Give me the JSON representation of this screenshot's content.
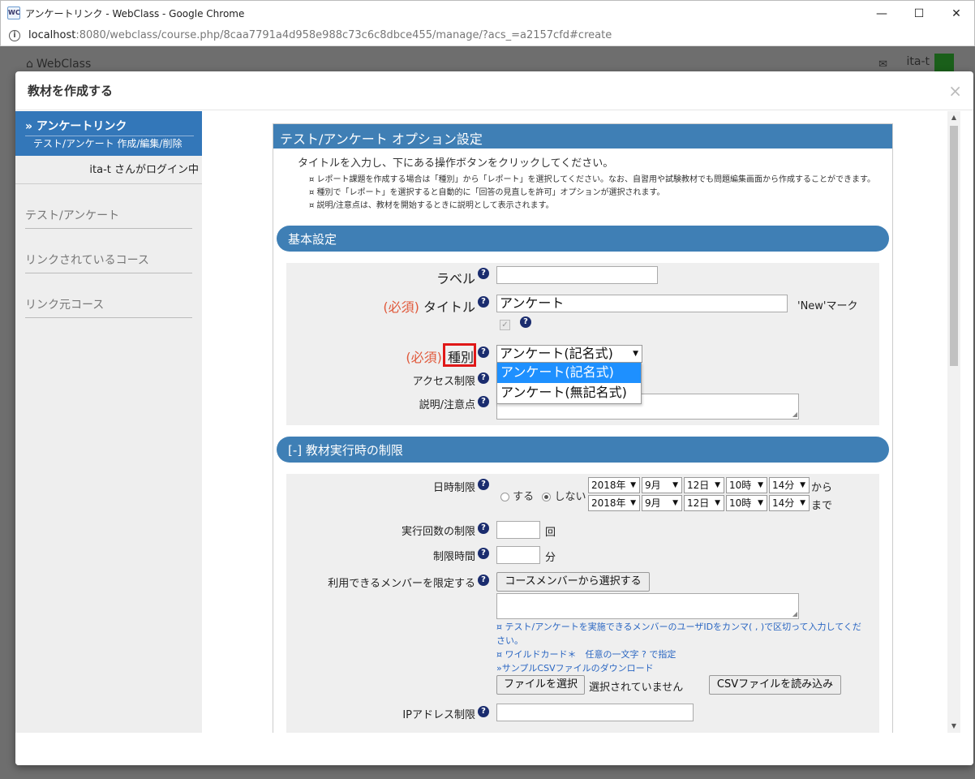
{
  "browser": {
    "window_title": "アンケートリンク - WebClass - Google Chrome",
    "favicon_text": "WC",
    "url_host": "localhost",
    "url_rest": ":8080/webclass/course.php/8caa7791a4d958e988c73c6c8dbce455/manage/?acs_=a2157cfd#create",
    "controls": {
      "minimize": "—",
      "maximize": "☐",
      "close": "✕"
    }
  },
  "background": {
    "brand": "WebClass",
    "user": "ita-t"
  },
  "modal": {
    "title": "教材を作成する",
    "close_label": "×"
  },
  "sidebar": {
    "head_title": "» アンケートリンク",
    "head_sub": "テスト/アンケート 作成/編集/削除",
    "login": "ita-t さんがログイン中",
    "links": [
      "テスト/アンケート",
      "リンクされているコース",
      "リンク元コース"
    ]
  },
  "panel": {
    "header": "テスト/アンケート オプション設定",
    "intro": "タイトルを入力し、下にある操作ボタンをクリックしてください。",
    "notes": [
      "¤ レポート課題を作成する場合は「種別」から「レポート」を選択してください。なお、自習用や試験教材でも問題編集画面から作成することができます。",
      "¤ 種別で「レポート」を選択すると自動的に「回答の見直しを許可」オプションが選択されます。",
      "¤ 説明/注意点は、教材を開始するときに説明として表示されます。"
    ]
  },
  "basic": {
    "section_title": "基本設定",
    "label_label": "ラベル",
    "label_value": "",
    "required_mark": "(必須)",
    "title_label": "タイトル",
    "title_value": "アンケート",
    "new_mark_label": "'New'マーク",
    "type_label": "種別",
    "type_value": "アンケート(記名式)",
    "type_options": [
      "アンケート(記名式)",
      "アンケート(無記名式)"
    ],
    "access_label": "アクセス制限",
    "desc_label": "説明/注意点"
  },
  "limits": {
    "section_title": "[-] 教材実行時の制限",
    "datetime_label": "日時制限",
    "radio_yes": "する",
    "radio_no": "しない",
    "from": {
      "year": "2018年",
      "month": "9月",
      "day": "12日",
      "hour": "10時",
      "minute": "14分",
      "suffix": "から"
    },
    "to": {
      "year": "2018年",
      "month": "9月",
      "day": "12日",
      "hour": "10時",
      "minute": "14分",
      "suffix": "まで"
    },
    "count_label": "実行回数の制限",
    "count_unit": "回",
    "time_label": "制限時間",
    "time_unit": "分",
    "members_label": "利用できるメンバーを限定する",
    "members_button": "コースメンバーから選択する",
    "members_note1": "¤ テスト/アンケートを実施できるメンバーのユーザIDをカンマ( , )で区切って入力してください。",
    "members_note2": "¤ ワイルドカード＊　任意の一文字 ? で指定",
    "members_note3": "»サンプルCSVファイルのダウンロード",
    "file_button": "ファイルを選択",
    "file_status": "選択されていません",
    "csv_button": "CSVファイルを読み込み",
    "ip_label": "IPアドレス制限"
  },
  "icons": {
    "help": "?",
    "home": "⌂",
    "mail": "✉",
    "info": "i",
    "check": "✓",
    "scroll_up": "▲",
    "scroll_down": "▼",
    "select_arrow": "▼",
    "resize": "◢"
  },
  "colors": {
    "accent": "#3f7fb5",
    "sidebar_active": "#3377b9",
    "required": "#e0583a",
    "highlight": "#e01818",
    "dropdown_selected": "#1e90ff",
    "link": "#2a66c2"
  }
}
